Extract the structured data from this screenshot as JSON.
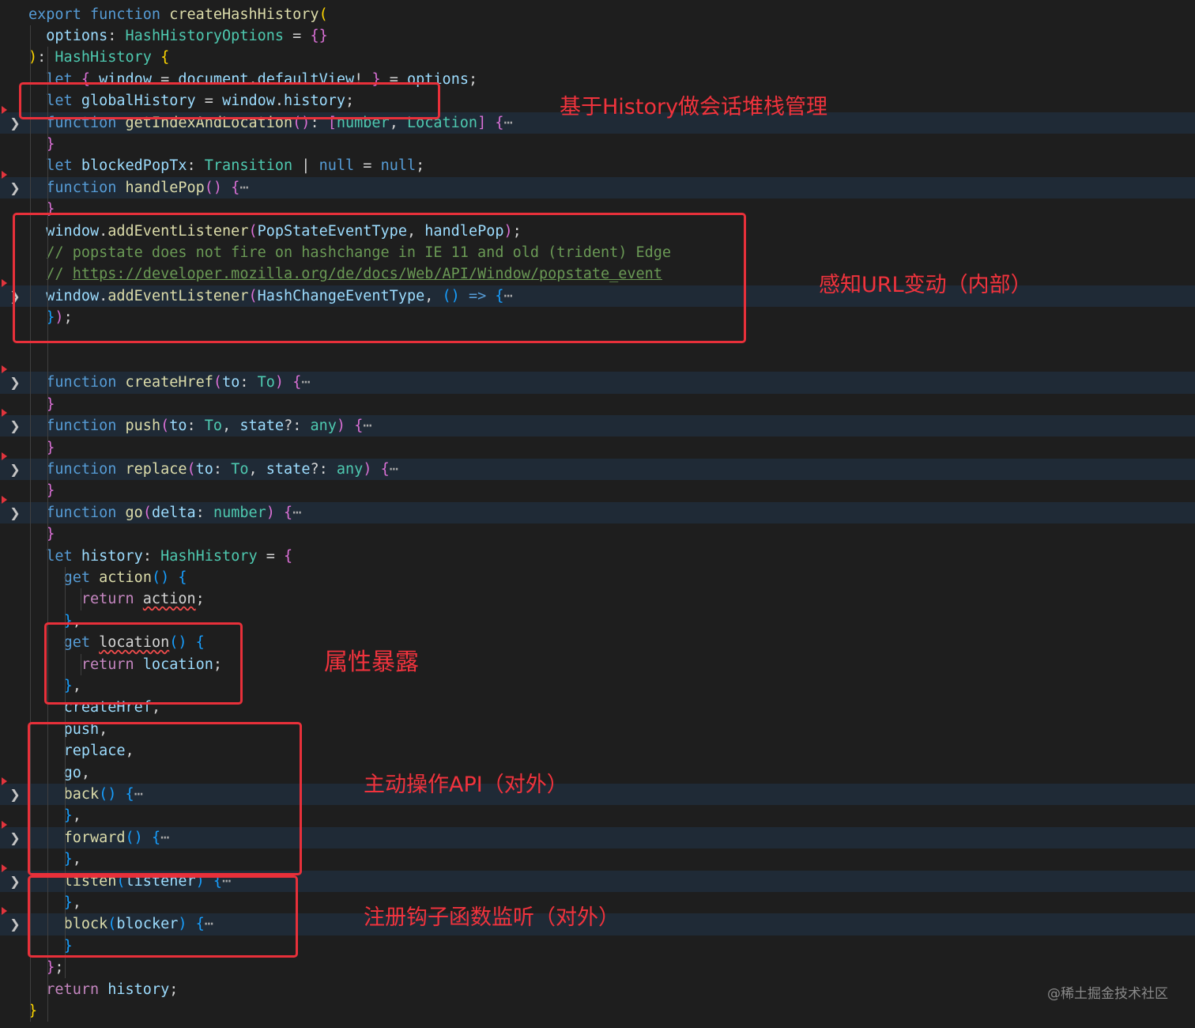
{
  "editor": {
    "lines": [
      {
        "tokens": [
          [
            "kw",
            "export"
          ],
          [
            "plain",
            " "
          ],
          [
            "kw",
            "function"
          ],
          [
            "plain",
            " "
          ],
          [
            "fn",
            "createHashHistory"
          ],
          [
            "b1",
            "("
          ]
        ]
      },
      {
        "tokens": [
          [
            "plain",
            "  "
          ],
          [
            "var",
            "options"
          ],
          [
            "plain",
            ": "
          ],
          [
            "type",
            "HashHistoryOptions"
          ],
          [
            "plain",
            " = "
          ],
          [
            "b2",
            "{}"
          ]
        ]
      },
      {
        "tokens": [
          [
            "b1",
            ")"
          ],
          [
            "plain",
            ": "
          ],
          [
            "type",
            "HashHistory"
          ],
          [
            "plain",
            " "
          ],
          [
            "b1",
            "{"
          ]
        ]
      },
      {
        "tokens": [
          [
            "plain",
            "  "
          ],
          [
            "kw",
            "let"
          ],
          [
            "plain",
            " "
          ],
          [
            "b2",
            "{"
          ],
          [
            "plain",
            " "
          ],
          [
            "var",
            "window"
          ],
          [
            "plain",
            " = "
          ],
          [
            "var",
            "document"
          ],
          [
            "plain",
            "."
          ],
          [
            "var",
            "defaultView"
          ],
          [
            "plain",
            "! "
          ],
          [
            "b2",
            "}"
          ],
          [
            "plain",
            " = "
          ],
          [
            "var",
            "options"
          ],
          [
            "plain",
            ";"
          ]
        ]
      },
      {
        "tokens": [
          [
            "plain",
            "  "
          ],
          [
            "kw",
            "let"
          ],
          [
            "plain",
            " "
          ],
          [
            "var",
            "globalHistory"
          ],
          [
            "plain",
            " = "
          ],
          [
            "var",
            "window"
          ],
          [
            "plain",
            "."
          ],
          [
            "var",
            "history"
          ],
          [
            "plain",
            ";"
          ]
        ]
      },
      {
        "tokens": [
          [
            "plain",
            "  "
          ],
          [
            "kw",
            "function"
          ],
          [
            "plain",
            " "
          ],
          [
            "fn",
            "getIndexAndLocation"
          ],
          [
            "b2",
            "()"
          ],
          [
            "plain",
            ": "
          ],
          [
            "b2",
            "["
          ],
          [
            "type",
            "number"
          ],
          [
            "plain",
            ", "
          ],
          [
            "type",
            "Location"
          ],
          [
            "b2",
            "]"
          ],
          [
            "plain",
            " "
          ],
          [
            "b2",
            "{"
          ],
          [
            "fold",
            "⋯"
          ]
        ]
      },
      {
        "tokens": [
          [
            "plain",
            "  "
          ],
          [
            "b2",
            "}"
          ]
        ]
      },
      {
        "tokens": [
          [
            "plain",
            "  "
          ],
          [
            "kw",
            "let"
          ],
          [
            "plain",
            " "
          ],
          [
            "var",
            "blockedPopTx"
          ],
          [
            "plain",
            ": "
          ],
          [
            "type",
            "Transition"
          ],
          [
            "plain",
            " | "
          ],
          [
            "kw",
            "null"
          ],
          [
            "plain",
            " = "
          ],
          [
            "kw",
            "null"
          ],
          [
            "plain",
            ";"
          ]
        ]
      },
      {
        "tokens": [
          [
            "plain",
            "  "
          ],
          [
            "kw",
            "function"
          ],
          [
            "plain",
            " "
          ],
          [
            "fn",
            "handlePop"
          ],
          [
            "b2",
            "()"
          ],
          [
            "plain",
            " "
          ],
          [
            "b2",
            "{"
          ],
          [
            "fold",
            "⋯"
          ]
        ]
      },
      {
        "tokens": [
          [
            "plain",
            "  "
          ],
          [
            "b2",
            "}"
          ]
        ]
      },
      {
        "tokens": [
          [
            "plain",
            "  "
          ],
          [
            "var",
            "window"
          ],
          [
            "plain",
            "."
          ],
          [
            "fn",
            "addEventListener"
          ],
          [
            "b2",
            "("
          ],
          [
            "var",
            "PopStateEventType"
          ],
          [
            "plain",
            ", "
          ],
          [
            "var",
            "handlePop"
          ],
          [
            "b2",
            ")"
          ],
          [
            "plain",
            ";"
          ]
        ]
      },
      {
        "tokens": [
          [
            "plain",
            "  "
          ],
          [
            "cm",
            "// popstate does not fire on hashchange in IE 11 and old (trident) Edge"
          ]
        ]
      },
      {
        "tokens": [
          [
            "plain",
            "  "
          ],
          [
            "cm",
            "// "
          ],
          [
            "link",
            "https://developer.mozilla.org/de/docs/Web/API/Window/popstate_event"
          ]
        ]
      },
      {
        "tokens": [
          [
            "plain",
            "  "
          ],
          [
            "var",
            "window"
          ],
          [
            "plain",
            "."
          ],
          [
            "fn",
            "addEventListener"
          ],
          [
            "b2",
            "("
          ],
          [
            "var",
            "HashChangeEventType"
          ],
          [
            "plain",
            ", "
          ],
          [
            "b3",
            "()"
          ],
          [
            "plain",
            " "
          ],
          [
            "kw",
            "=>"
          ],
          [
            "plain",
            " "
          ],
          [
            "b3",
            "{"
          ],
          [
            "fold",
            "⋯"
          ]
        ]
      },
      {
        "tokens": [
          [
            "plain",
            "  "
          ],
          [
            "b3",
            "}"
          ],
          [
            "b2",
            ")"
          ],
          [
            "plain",
            ";"
          ]
        ]
      },
      {
        "tokens": []
      },
      {
        "tokens": []
      },
      {
        "tokens": [
          [
            "plain",
            "  "
          ],
          [
            "kw",
            "function"
          ],
          [
            "plain",
            " "
          ],
          [
            "fn",
            "createHref"
          ],
          [
            "b2",
            "("
          ],
          [
            "var",
            "to"
          ],
          [
            "plain",
            ": "
          ],
          [
            "type",
            "To"
          ],
          [
            "b2",
            ")"
          ],
          [
            "plain",
            " "
          ],
          [
            "b2",
            "{"
          ],
          [
            "fold",
            "⋯"
          ]
        ]
      },
      {
        "tokens": [
          [
            "plain",
            "  "
          ],
          [
            "b2",
            "}"
          ]
        ]
      },
      {
        "tokens": [
          [
            "plain",
            "  "
          ],
          [
            "kw",
            "function"
          ],
          [
            "plain",
            " "
          ],
          [
            "fn",
            "push"
          ],
          [
            "b2",
            "("
          ],
          [
            "var",
            "to"
          ],
          [
            "plain",
            ": "
          ],
          [
            "type",
            "To"
          ],
          [
            "plain",
            ", "
          ],
          [
            "var",
            "state"
          ],
          [
            "plain",
            "?: "
          ],
          [
            "type",
            "any"
          ],
          [
            "b2",
            ")"
          ],
          [
            "plain",
            " "
          ],
          [
            "b2",
            "{"
          ],
          [
            "fold",
            "⋯"
          ]
        ]
      },
      {
        "tokens": [
          [
            "plain",
            "  "
          ],
          [
            "b2",
            "}"
          ]
        ]
      },
      {
        "tokens": [
          [
            "plain",
            "  "
          ],
          [
            "kw",
            "function"
          ],
          [
            "plain",
            " "
          ],
          [
            "fn",
            "replace"
          ],
          [
            "b2",
            "("
          ],
          [
            "var",
            "to"
          ],
          [
            "plain",
            ": "
          ],
          [
            "type",
            "To"
          ],
          [
            "plain",
            ", "
          ],
          [
            "var",
            "state"
          ],
          [
            "plain",
            "?: "
          ],
          [
            "type",
            "any"
          ],
          [
            "b2",
            ")"
          ],
          [
            "plain",
            " "
          ],
          [
            "b2",
            "{"
          ],
          [
            "fold",
            "⋯"
          ]
        ]
      },
      {
        "tokens": [
          [
            "plain",
            "  "
          ],
          [
            "b2",
            "}"
          ]
        ]
      },
      {
        "tokens": [
          [
            "plain",
            "  "
          ],
          [
            "kw",
            "function"
          ],
          [
            "plain",
            " "
          ],
          [
            "fn",
            "go"
          ],
          [
            "b2",
            "("
          ],
          [
            "var",
            "delta"
          ],
          [
            "plain",
            ": "
          ],
          [
            "type",
            "number"
          ],
          [
            "b2",
            ")"
          ],
          [
            "plain",
            " "
          ],
          [
            "b2",
            "{"
          ],
          [
            "fold",
            "⋯"
          ]
        ]
      },
      {
        "tokens": [
          [
            "plain",
            "  "
          ],
          [
            "b2",
            "}"
          ]
        ]
      },
      {
        "tokens": [
          [
            "plain",
            "  "
          ],
          [
            "kw",
            "let"
          ],
          [
            "plain",
            " "
          ],
          [
            "var",
            "history"
          ],
          [
            "plain",
            ": "
          ],
          [
            "type",
            "HashHistory"
          ],
          [
            "plain",
            " = "
          ],
          [
            "b2",
            "{"
          ]
        ]
      },
      {
        "tokens": [
          [
            "plain",
            "    "
          ],
          [
            "kw",
            "get"
          ],
          [
            "plain",
            " "
          ],
          [
            "fn",
            "action"
          ],
          [
            "b3",
            "()"
          ],
          [
            "plain",
            " "
          ],
          [
            "b3",
            "{"
          ]
        ]
      },
      {
        "tokens": [
          [
            "plain",
            "      "
          ],
          [
            "ctl",
            "return"
          ],
          [
            "plain",
            " "
          ],
          [
            "squig",
            "action"
          ],
          [
            "plain",
            ";"
          ]
        ]
      },
      {
        "tokens": [
          [
            "plain",
            "    "
          ],
          [
            "b3",
            "}"
          ],
          [
            "plain",
            ","
          ]
        ]
      },
      {
        "tokens": [
          [
            "plain",
            "    "
          ],
          [
            "kw",
            "get"
          ],
          [
            "plain",
            " "
          ],
          [
            "squig",
            "location"
          ],
          [
            "b3",
            "()"
          ],
          [
            "plain",
            " "
          ],
          [
            "b3",
            "{"
          ]
        ]
      },
      {
        "tokens": [
          [
            "plain",
            "      "
          ],
          [
            "ctl",
            "return"
          ],
          [
            "plain",
            " "
          ],
          [
            "var",
            "location"
          ],
          [
            "plain",
            ";"
          ]
        ]
      },
      {
        "tokens": [
          [
            "plain",
            "    "
          ],
          [
            "b3",
            "}"
          ],
          [
            "plain",
            ","
          ]
        ]
      },
      {
        "tokens": [
          [
            "plain",
            "    "
          ],
          [
            "var",
            "createHref"
          ],
          [
            "plain",
            ","
          ]
        ]
      },
      {
        "tokens": [
          [
            "plain",
            "    "
          ],
          [
            "var",
            "push"
          ],
          [
            "plain",
            ","
          ]
        ]
      },
      {
        "tokens": [
          [
            "plain",
            "    "
          ],
          [
            "var",
            "replace"
          ],
          [
            "plain",
            ","
          ]
        ]
      },
      {
        "tokens": [
          [
            "plain",
            "    "
          ],
          [
            "var",
            "go"
          ],
          [
            "plain",
            ","
          ]
        ]
      },
      {
        "tokens": [
          [
            "plain",
            "    "
          ],
          [
            "fn",
            "back"
          ],
          [
            "b3",
            "()"
          ],
          [
            "plain",
            " "
          ],
          [
            "b3",
            "{"
          ],
          [
            "fold",
            "⋯"
          ]
        ]
      },
      {
        "tokens": [
          [
            "plain",
            "    "
          ],
          [
            "b3",
            "}"
          ],
          [
            "plain",
            ","
          ]
        ]
      },
      {
        "tokens": [
          [
            "plain",
            "    "
          ],
          [
            "fn",
            "forward"
          ],
          [
            "b3",
            "()"
          ],
          [
            "plain",
            " "
          ],
          [
            "b3",
            "{"
          ],
          [
            "fold",
            "⋯"
          ]
        ]
      },
      {
        "tokens": [
          [
            "plain",
            "    "
          ],
          [
            "b3",
            "}"
          ],
          [
            "plain",
            ","
          ]
        ]
      },
      {
        "tokens": [
          [
            "plain",
            "    "
          ],
          [
            "fn",
            "listen"
          ],
          [
            "b3",
            "("
          ],
          [
            "var",
            "listener"
          ],
          [
            "b3",
            ")"
          ],
          [
            "plain",
            " "
          ],
          [
            "b3",
            "{"
          ],
          [
            "fold",
            "⋯"
          ]
        ]
      },
      {
        "tokens": [
          [
            "plain",
            "    "
          ],
          [
            "b3",
            "}"
          ],
          [
            "plain",
            ","
          ]
        ]
      },
      {
        "tokens": [
          [
            "plain",
            "    "
          ],
          [
            "fn",
            "block"
          ],
          [
            "b3",
            "("
          ],
          [
            "var",
            "blocker"
          ],
          [
            "b3",
            ")"
          ],
          [
            "plain",
            " "
          ],
          [
            "b3",
            "{"
          ],
          [
            "fold",
            "⋯"
          ]
        ]
      },
      {
        "tokens": [
          [
            "plain",
            "    "
          ],
          [
            "b3",
            "}"
          ]
        ]
      },
      {
        "tokens": [
          [
            "plain",
            "  "
          ],
          [
            "b2",
            "}"
          ],
          [
            "plain",
            ";"
          ]
        ]
      },
      {
        "tokens": [
          [
            "plain",
            "  "
          ],
          [
            "ctl",
            "return"
          ],
          [
            "plain",
            " "
          ],
          [
            "var",
            "history"
          ],
          [
            "plain",
            ";"
          ]
        ]
      },
      {
        "tokens": [
          [
            "b1",
            "}"
          ]
        ]
      }
    ],
    "folded_lines": [
      5,
      8,
      13,
      17,
      19,
      21,
      23,
      36,
      38,
      40,
      42
    ]
  },
  "annotations": {
    "history_stack": "基于History做会话堆栈管理",
    "url_listen": "感知URL变动（内部）",
    "props_exposed": "属性暴露",
    "active_api": "主动操作API（对外）",
    "hook_listen": "注册钩子函数监听（对外）"
  },
  "watermark": "@稀土掘金技术社区"
}
